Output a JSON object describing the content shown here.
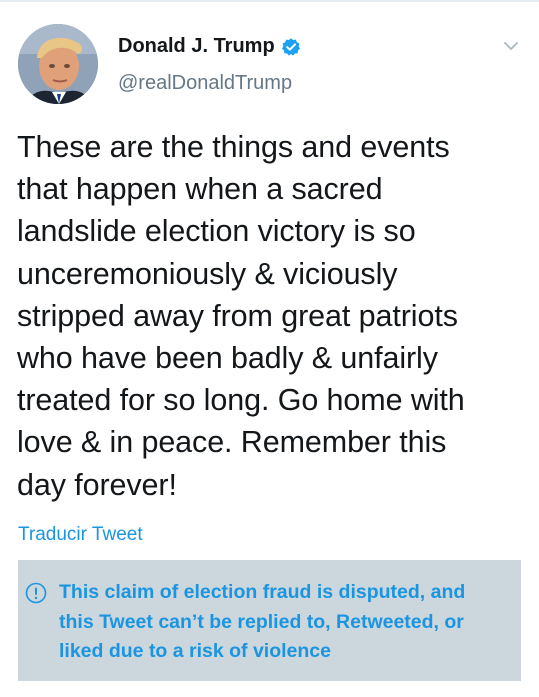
{
  "tweet": {
    "author_name": "Donald J. Trump",
    "author_handle": "@realDonaldTrump",
    "avatar_icon": "avatar-photo",
    "verified_icon": "verified-badge-icon",
    "menu_icon": "chevron-down-icon",
    "text": "These are the things and events\nthat happen when a sacred\nlandslide election victory is so\nunceremoniously & viciously\nstripped away from great patriots\nwho have been badly & unfairly\ntreated for so long. Go home with\nlove & in peace. Remember this\nday forever!",
    "translate_label": "Traducir Tweet"
  },
  "notice": {
    "icon": "exclamation-circle-icon",
    "text": "This claim of election fraud is disputed, and\nthis Tweet can’t be replied to, Retweeted, or\nliked due to a risk of violence"
  },
  "colors": {
    "accent": "#1b95e0",
    "notice_background": "#ccd6dd",
    "secondary_text": "#657786",
    "primary_text": "#14171a"
  }
}
